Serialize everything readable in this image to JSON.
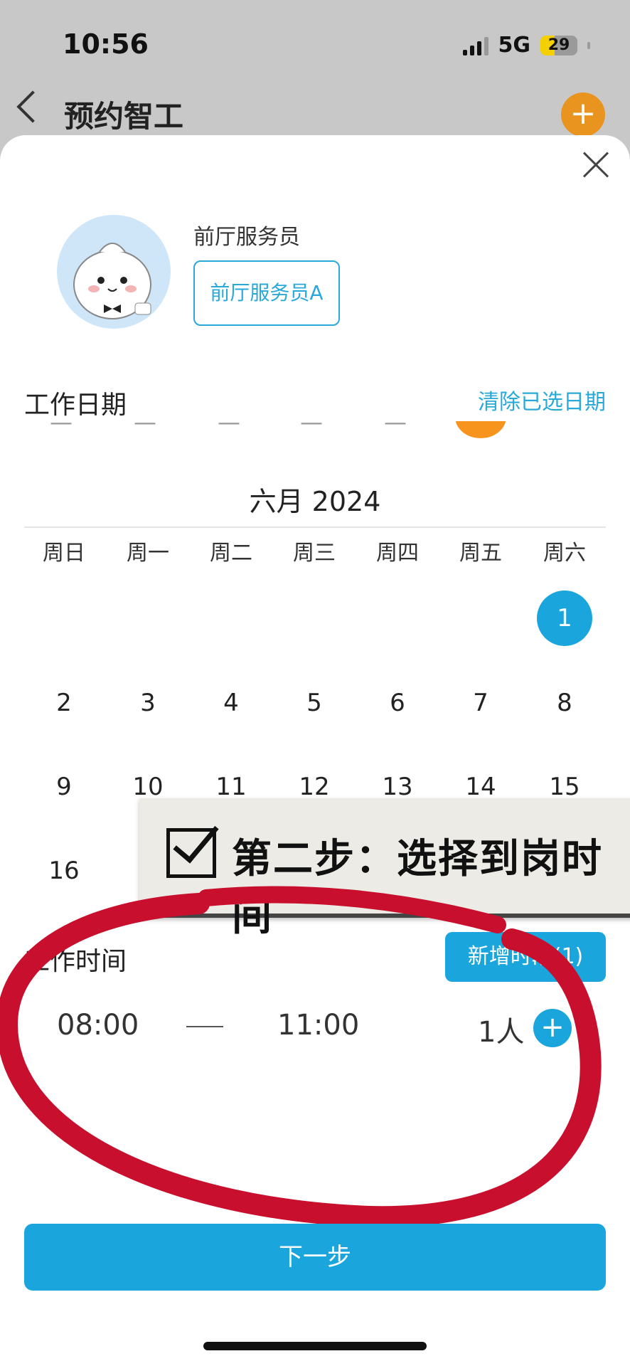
{
  "status_bar": {
    "time": "10:56",
    "network": "5G",
    "battery": "29"
  },
  "nav": {
    "title": "预约智工"
  },
  "role": {
    "label": "前厅服务员",
    "person_button": "前厅服务员A"
  },
  "work_date": {
    "title": "工作日期",
    "clear_label": "清除已选日期",
    "month_label": "六月 2024",
    "weekdays": [
      "周日",
      "周一",
      "周二",
      "周三",
      "周四",
      "周五",
      "周六"
    ],
    "selected_day": "1",
    "days": [
      "1",
      "2",
      "3",
      "4",
      "5",
      "6",
      "7",
      "8",
      "9",
      "10",
      "11",
      "12",
      "13",
      "14",
      "15",
      "16",
      "1"
    ]
  },
  "overlay": {
    "caption": "第二步：选择到岗时间"
  },
  "work_time": {
    "title": "工作时间",
    "add_slot_label": "新增时段(1)",
    "start": "08:00",
    "end": "11:00",
    "count": "1人"
  },
  "footer": {
    "next_label": "下一步"
  },
  "colors": {
    "accent": "#1aa6dd",
    "orange": "#f7941d",
    "annotation_red": "#c8102e"
  }
}
